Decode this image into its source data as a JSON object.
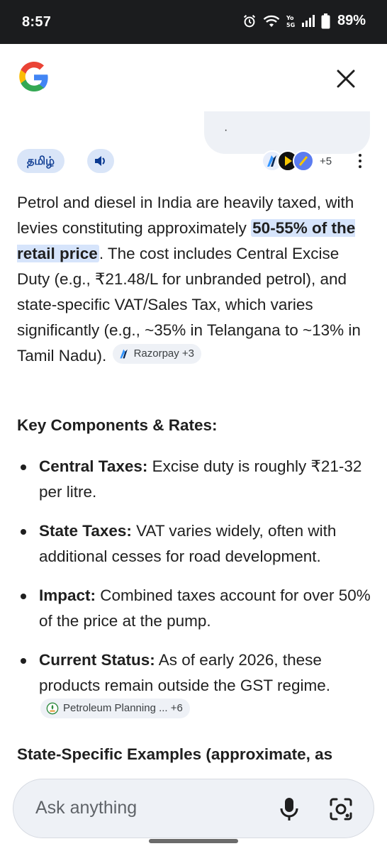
{
  "status_bar": {
    "time": "8:57",
    "battery": "89%",
    "icons": [
      "alarm-icon",
      "wifi-icon",
      "volte-icon",
      "signal-icon",
      "battery-icon"
    ]
  },
  "header": {
    "logo": "google-g-logo",
    "close_icon": "close-icon"
  },
  "user_query_bubble": {
    "visible_text": "·"
  },
  "answer": {
    "language_chip": "தமிழ்",
    "speaker_icon": "speaker-icon",
    "sources_count": "+5",
    "more_icon": "more-vert-icon",
    "paragraph": {
      "part1": "Petrol and diesel in India are heavily taxed, with levies constituting approximately ",
      "highlight": "50-55% of the retail price",
      "part2": ". The cost includes Central Excise Duty (e.g., ₹21.48/L for unbranded petrol), and state-specific VAT/Sales Tax, which varies significantly (e.g., ~35% in Telangana to ~13% in Tamil Nadu).",
      "citation": "Razorpay +3"
    },
    "heading": "Key Components & Rates:",
    "bullets": [
      {
        "label": "Central Taxes:",
        "text": " Excise duty is roughly ₹21-32 per litre."
      },
      {
        "label": "State Taxes:",
        "text": " VAT varies widely, often with additional cesses for road development."
      },
      {
        "label": "Impact:",
        "text": " Combined taxes account for over 50% of the price at the pump."
      },
      {
        "label": "Current Status:",
        "text": " As of early 2026, these products remain outside the GST regime.",
        "citation": "Petroleum Planning ... +6"
      }
    ],
    "heading2": "State-Specific Examples (approximate, as"
  },
  "ask_bar": {
    "placeholder": "Ask anything",
    "mic_icon": "mic-icon",
    "lens_icon": "lens-icon"
  },
  "colors": {
    "accent_bg": "#d9e5f8",
    "highlight_bg": "#d6e4fb",
    "status_bar_bg": "#1b1c1e"
  }
}
